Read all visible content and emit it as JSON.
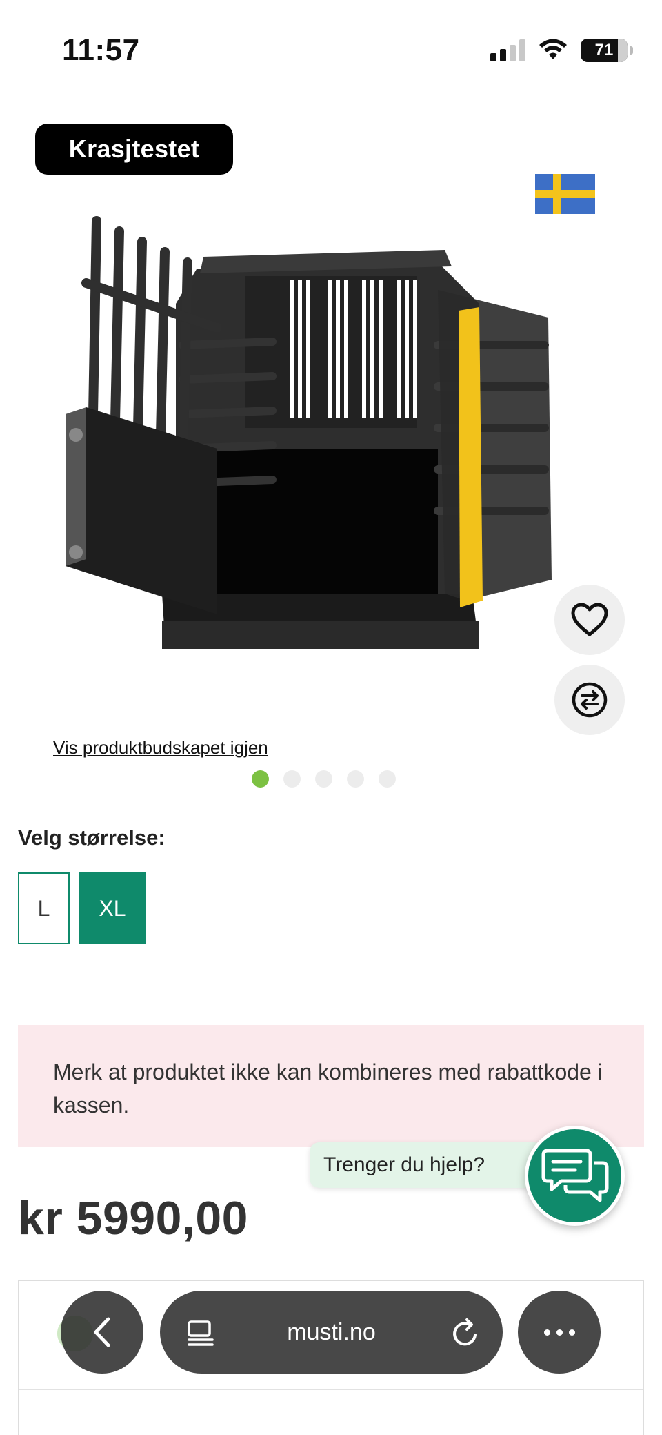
{
  "status_bar": {
    "time": "11:57",
    "battery": "71"
  },
  "product": {
    "badge": "Krasjtestet",
    "show_message_link": "Vis produktbudskapet igjen",
    "image_count": 5,
    "active_image": 1
  },
  "size_selector": {
    "label": "Velg størrelse:",
    "options": [
      {
        "label": "L",
        "selected": false
      },
      {
        "label": "XL",
        "selected": true
      }
    ]
  },
  "notice": "Merk at produktet ikke kan kombineres med rabattkode i kassen.",
  "help": {
    "bubble_text": "Trenger du hjelp?"
  },
  "price": "kr 5990,00",
  "browser": {
    "url": "musti.no"
  },
  "colors": {
    "accent_green": "#0f8a6b",
    "dot_active": "#7cc142",
    "notice_bg": "#fbe9ec"
  }
}
